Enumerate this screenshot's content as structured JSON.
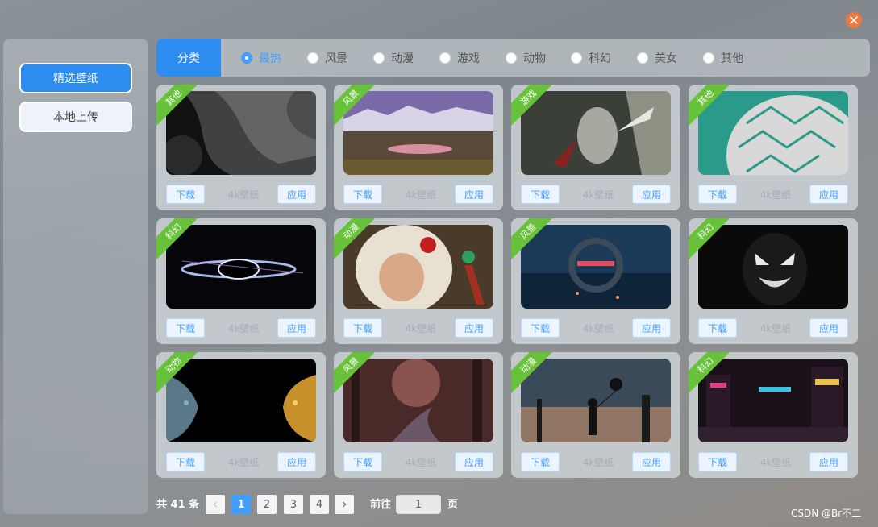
{
  "sidebar": {
    "featured_label": "精选壁纸",
    "upload_label": "本地上传"
  },
  "category": {
    "title": "分类",
    "options": [
      "最热",
      "风景",
      "动漫",
      "游戏",
      "动物",
      "科幻",
      "美女",
      "其他"
    ],
    "selected": "最热"
  },
  "cards": [
    {
      "tag": "其他",
      "download": "下载",
      "res": "4k壁纸",
      "apply": "应用"
    },
    {
      "tag": "风景",
      "download": "下载",
      "res": "4k壁纸",
      "apply": "应用"
    },
    {
      "tag": "游戏",
      "download": "下载",
      "res": "4k壁纸",
      "apply": "应用"
    },
    {
      "tag": "其他",
      "download": "下载",
      "res": "4k壁纸",
      "apply": "应用"
    },
    {
      "tag": "科幻",
      "download": "下载",
      "res": "4k壁纸",
      "apply": "应用"
    },
    {
      "tag": "动漫",
      "download": "下载",
      "res": "4k壁纸",
      "apply": "应用"
    },
    {
      "tag": "风景",
      "download": "下载",
      "res": "4k壁纸",
      "apply": "应用"
    },
    {
      "tag": "科幻",
      "download": "下载",
      "res": "4k壁纸",
      "apply": "应用"
    },
    {
      "tag": "动物",
      "download": "下载",
      "res": "4k壁纸",
      "apply": "应用"
    },
    {
      "tag": "风景",
      "download": "下载",
      "res": "4k壁纸",
      "apply": "应用"
    },
    {
      "tag": "动漫",
      "download": "下载",
      "res": "4k壁纸",
      "apply": "应用"
    },
    {
      "tag": "科幻",
      "download": "下载",
      "res": "4k壁纸",
      "apply": "应用"
    }
  ],
  "pagination": {
    "total_text": "共 41 条",
    "pages": [
      "1",
      "2",
      "3",
      "4"
    ],
    "current": "1",
    "goto_label": "前往",
    "goto_value": "1",
    "page_suffix": "页"
  },
  "watermark": "CSDN @Br不二",
  "colors": {
    "primary": "#2d8cf0",
    "tag": "#67c23a",
    "close": "#f0783c"
  },
  "icons": {
    "close": "close-icon",
    "prev": "chevron-left-icon",
    "next": "chevron-right-icon"
  }
}
